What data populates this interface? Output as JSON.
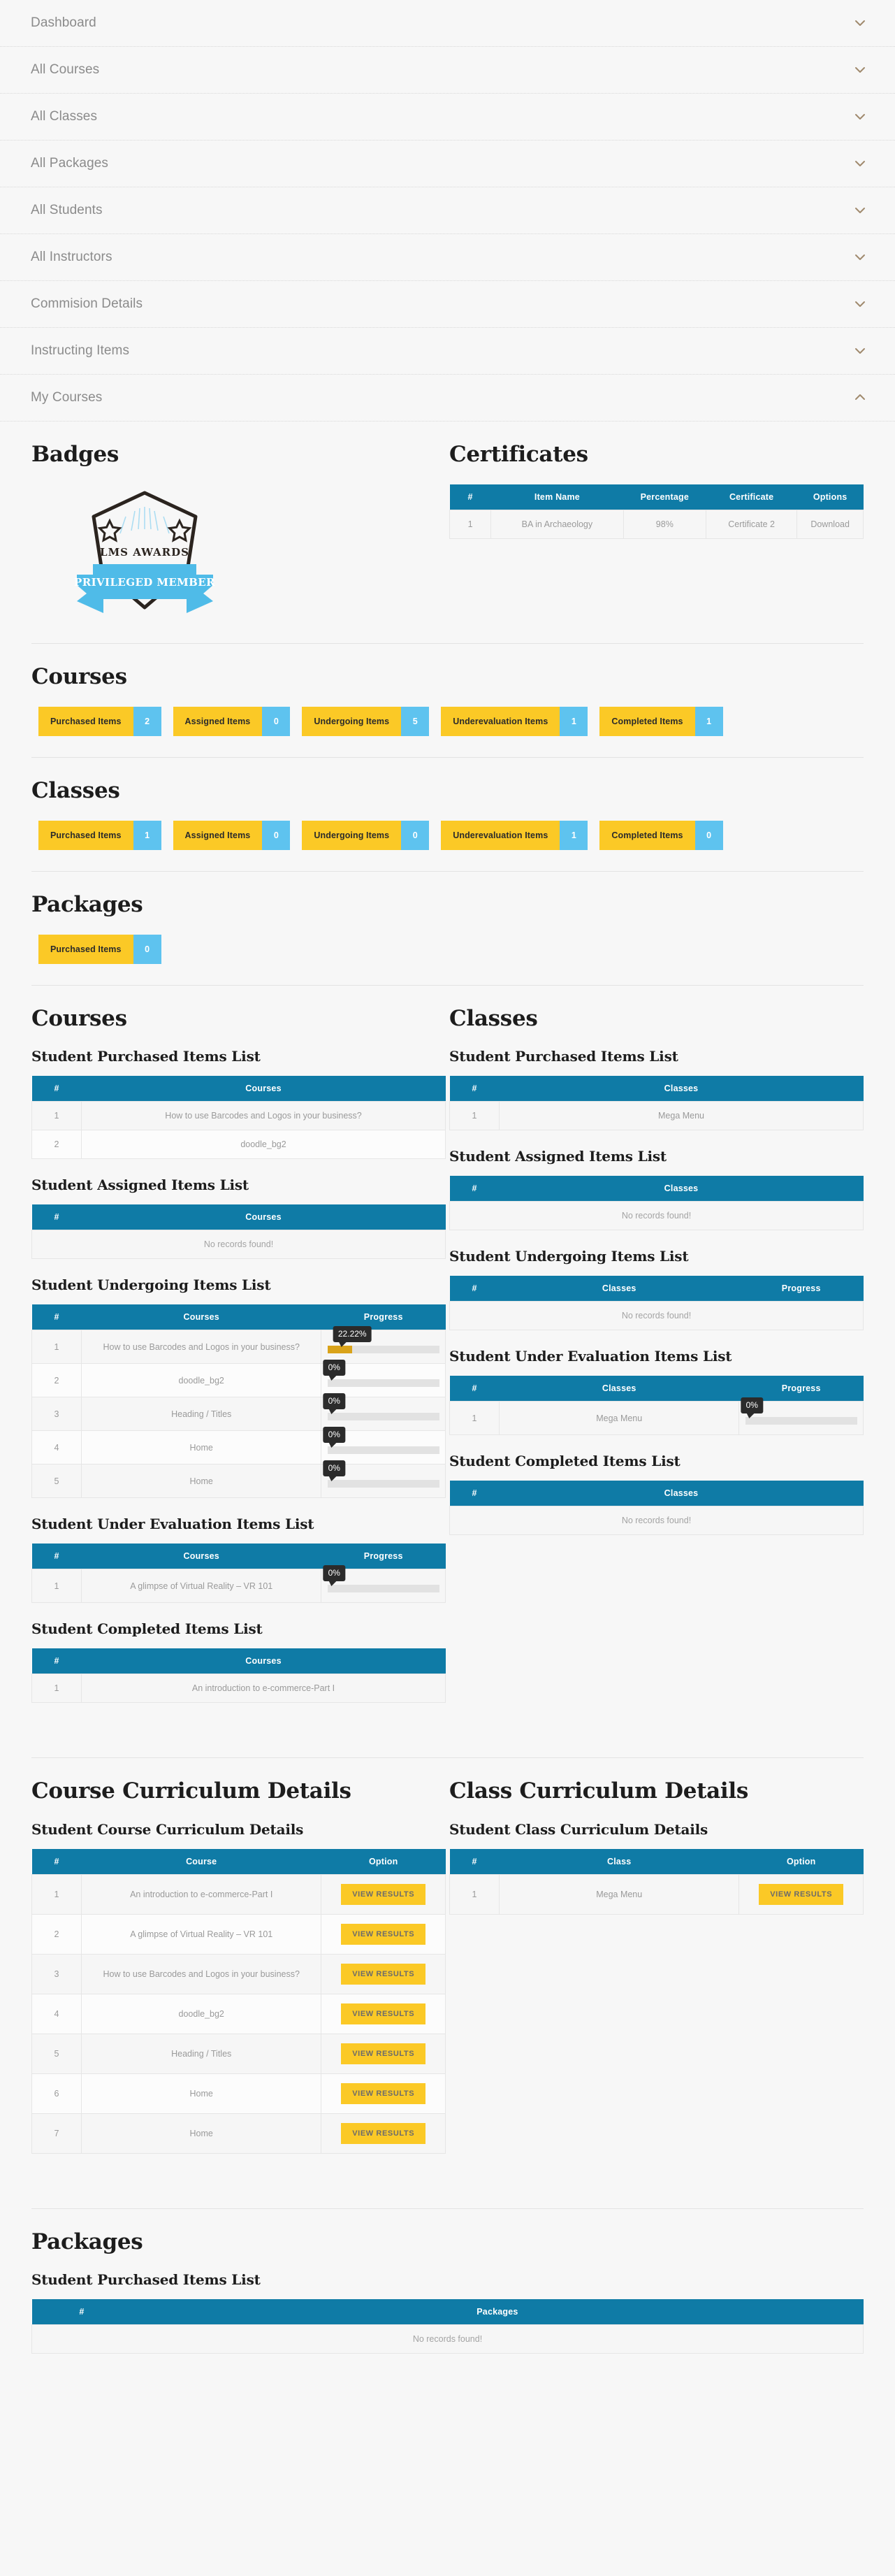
{
  "accordion": {
    "items": [
      {
        "label": "Dashboard",
        "icon": "chevron-down-icon",
        "expanded": false
      },
      {
        "label": "All Courses",
        "icon": "chevron-down-icon",
        "expanded": false
      },
      {
        "label": "All Classes",
        "icon": "chevron-down-icon",
        "expanded": false
      },
      {
        "label": "All Packages",
        "icon": "chevron-down-icon",
        "expanded": false
      },
      {
        "label": "All Students",
        "icon": "chevron-down-icon",
        "expanded": false
      },
      {
        "label": "All Instructors",
        "icon": "chevron-down-icon",
        "expanded": false
      },
      {
        "label": "Commision Details",
        "icon": "chevron-down-icon",
        "expanded": false
      },
      {
        "label": "Instructing Items",
        "icon": "chevron-down-icon",
        "expanded": false
      },
      {
        "label": "My Courses",
        "icon": "chevron-up-icon",
        "expanded": true
      }
    ]
  },
  "badges": {
    "title": "Badges",
    "badge": {
      "award_text": "LMS AWARDS",
      "ribbon_text": "PRIVILEGED MEMBER"
    }
  },
  "certificates": {
    "title": "Certificates",
    "columns": [
      "#",
      "Item Name",
      "Percentage",
      "Certificate",
      "Options"
    ],
    "rows": [
      {
        "num": "1",
        "item_name": "BA in Archaeology",
        "percentage": "98%",
        "certificate": "Certificate 2",
        "option": "Download"
      }
    ]
  },
  "courses_summary": {
    "title": "Courses",
    "pills": [
      {
        "label": "Purchased Items",
        "count": "2"
      },
      {
        "label": "Assigned Items",
        "count": "0"
      },
      {
        "label": "Undergoing Items",
        "count": "5"
      },
      {
        "label": "Underevaluation Items",
        "count": "1"
      },
      {
        "label": "Completed Items",
        "count": "1"
      }
    ]
  },
  "classes_summary": {
    "title": "Classes",
    "pills": [
      {
        "label": "Purchased Items",
        "count": "1"
      },
      {
        "label": "Assigned Items",
        "count": "0"
      },
      {
        "label": "Undergoing Items",
        "count": "0"
      },
      {
        "label": "Underevaluation Items",
        "count": "1"
      },
      {
        "label": "Completed Items",
        "count": "0"
      }
    ]
  },
  "packages_summary": {
    "title": "Packages",
    "pills": [
      {
        "label": "Purchased Items",
        "count": "0"
      }
    ]
  },
  "courses_lists": {
    "title": "Courses",
    "col_num": "#",
    "col_item": "Courses",
    "col_progress": "Progress",
    "empty_text": "No records found!",
    "purchased": {
      "title": "Student Purchased Items List",
      "rows": [
        {
          "num": "1",
          "name": "How to use Barcodes and Logos in your business?"
        },
        {
          "num": "2",
          "name": "doodle_bg2"
        }
      ]
    },
    "assigned": {
      "title": "Student Assigned Items List",
      "rows": []
    },
    "undergoing": {
      "title": "Student Undergoing Items List",
      "rows": [
        {
          "num": "1",
          "name": "How to use Barcodes and Logos in your business?",
          "progress": "22.22%",
          "progress_value": 22.22
        },
        {
          "num": "2",
          "name": "doodle_bg2",
          "progress": "0%",
          "progress_value": 0
        },
        {
          "num": "3",
          "name": "Heading / Titles",
          "progress": "0%",
          "progress_value": 0
        },
        {
          "num": "4",
          "name": "Home",
          "progress": "0%",
          "progress_value": 0
        },
        {
          "num": "5",
          "name": "Home",
          "progress": "0%",
          "progress_value": 0
        }
      ]
    },
    "under_evaluation": {
      "title": "Student Under Evaluation Items List",
      "rows": [
        {
          "num": "1",
          "name": "A glimpse of Virtual Reality – VR 101",
          "progress": "0%",
          "progress_value": 0
        }
      ]
    },
    "completed": {
      "title": "Student Completed Items List",
      "rows": [
        {
          "num": "1",
          "name": "An introduction to e-commerce-Part I"
        }
      ]
    }
  },
  "classes_lists": {
    "title": "Classes",
    "col_num": "#",
    "col_item": "Classes",
    "col_progress": "Progress",
    "empty_text": "No records found!",
    "purchased": {
      "title": "Student Purchased Items List",
      "rows": [
        {
          "num": "1",
          "name": "Mega Menu"
        }
      ]
    },
    "assigned": {
      "title": "Student Assigned Items List",
      "rows": []
    },
    "undergoing": {
      "title": "Student Undergoing Items List",
      "rows": []
    },
    "under_evaluation": {
      "title": "Student Under Evaluation Items List",
      "rows": [
        {
          "num": "1",
          "name": "Mega Menu",
          "progress": "0%",
          "progress_value": 0
        }
      ]
    },
    "completed": {
      "title": "Student Completed Items List",
      "rows": []
    }
  },
  "course_curriculum": {
    "title": "Course Curriculum Details",
    "subtitle": "Student Course Curriculum Details",
    "columns": [
      "#",
      "Course",
      "Option"
    ],
    "button_label": "VIEW RESULTS",
    "rows": [
      {
        "num": "1",
        "name": "An introduction to e-commerce-Part I"
      },
      {
        "num": "2",
        "name": "A glimpse of Virtual Reality – VR 101"
      },
      {
        "num": "3",
        "name": "How to use Barcodes and Logos in your business?"
      },
      {
        "num": "4",
        "name": "doodle_bg2"
      },
      {
        "num": "5",
        "name": "Heading / Titles"
      },
      {
        "num": "6",
        "name": "Home"
      },
      {
        "num": "7",
        "name": "Home"
      }
    ]
  },
  "class_curriculum": {
    "title": "Class Curriculum Details",
    "subtitle": "Student Class Curriculum Details",
    "columns": [
      "#",
      "Class",
      "Option"
    ],
    "button_label": "VIEW RESULTS",
    "rows": [
      {
        "num": "1",
        "name": "Mega Menu"
      }
    ]
  },
  "packages_lists": {
    "title": "Packages",
    "subtitle": "Student Purchased Items List",
    "col_num": "#",
    "col_item": "Packages",
    "empty_text": "No records found!",
    "rows": []
  },
  "colors": {
    "table_header": "#0f7ba6",
    "pill_label": "#fbc926",
    "pill_count": "#5ec3ef",
    "progress_fill": "#d9a31a",
    "tooltip_bg": "#2b2b2b",
    "page_bg": "#f7f7f7"
  }
}
